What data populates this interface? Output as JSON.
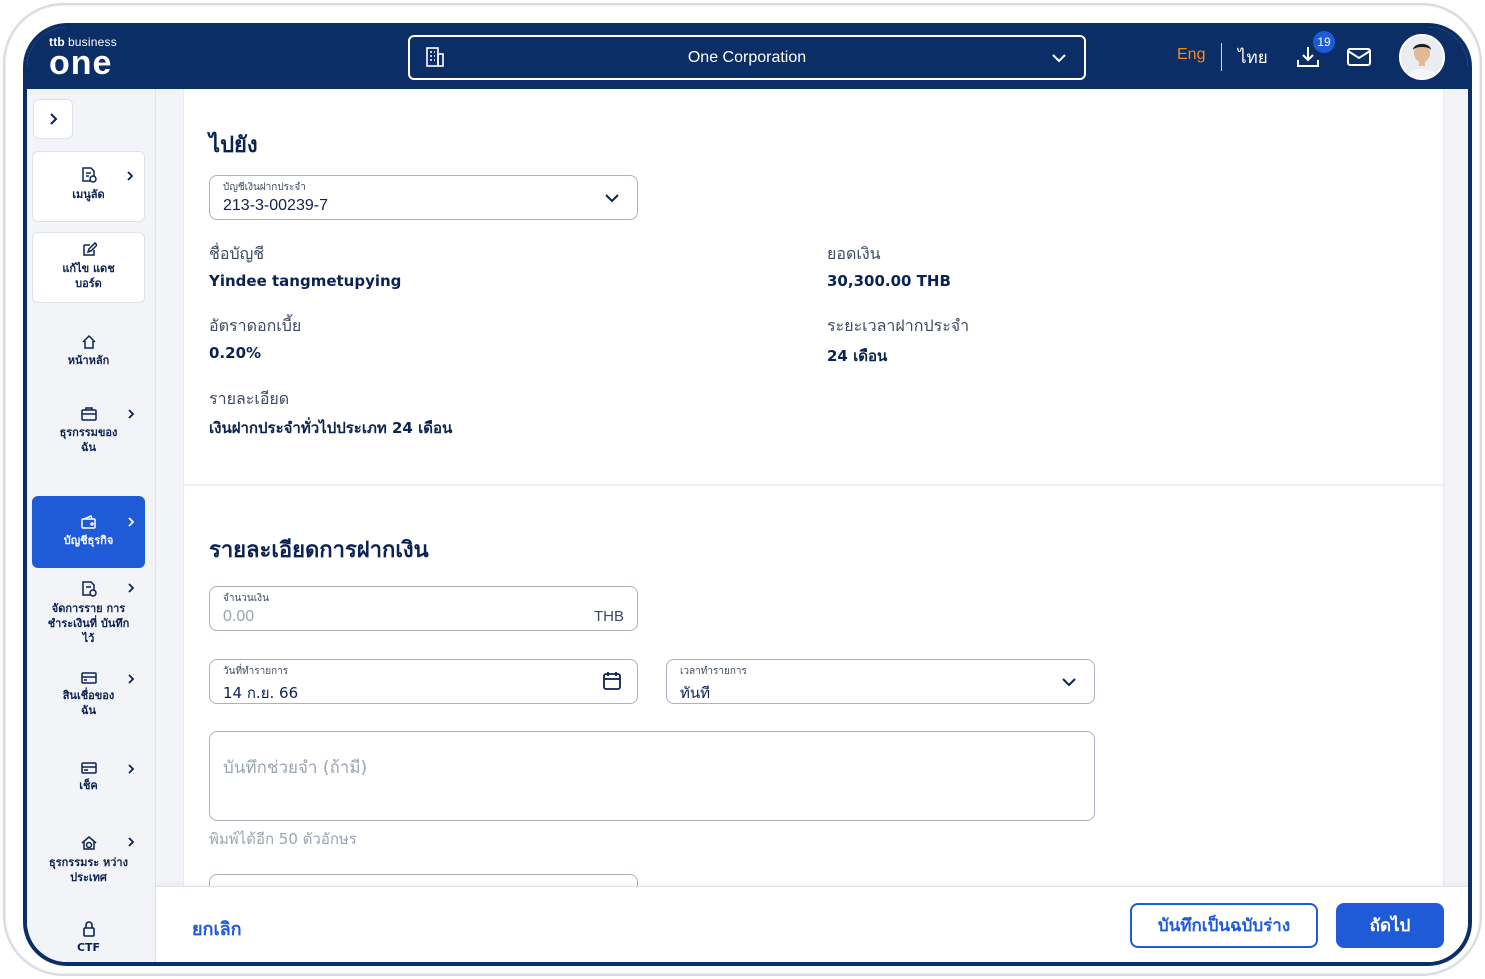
{
  "header": {
    "logo_small_prefix": "ttb",
    "logo_small": "business",
    "logo_big": "one",
    "company": "One Corporation",
    "lang_eng": "Eng",
    "lang_thai": "ไทย",
    "download_badge": "19"
  },
  "sidebar": {
    "items": [
      {
        "label": "เมนูลัด",
        "icon": "document-star-icon"
      },
      {
        "label": "แก้ไข แดชบอร์ด",
        "icon": "edit-icon"
      },
      {
        "label": "หน้าหลัก",
        "icon": "home-icon"
      },
      {
        "label": "ธุรกรรมของ ฉัน",
        "icon": "briefcase-icon"
      },
      {
        "label": "บัญชีธุรกิจ",
        "icon": "wallet-icon"
      },
      {
        "label": "จัดการราย การชำระเงินที่ บันทึกไว้",
        "icon": "document-pay-icon"
      },
      {
        "label": "สินเชื่อของ ฉัน",
        "icon": "card-icon"
      },
      {
        "label": "เช็ค",
        "icon": "cheque-icon"
      },
      {
        "label": "ธุรกรรมระ หว่างประเทศ",
        "icon": "globe-house-icon"
      },
      {
        "label": "CTF",
        "icon": "lock-icon"
      }
    ]
  },
  "destination": {
    "title": "ไปยัง",
    "account_field_label": "บัญชีเงินฝากประจำ",
    "account_number": "213-3-00239-7",
    "account_name_label": "ชื่อบัญชี",
    "account_name": "Yindee tangmetupying",
    "balance_label": "ยอดเงิน",
    "balance": "30,300.00 THB",
    "interest_label": "อัตราดอกเบี้ย",
    "interest": "0.20%",
    "term_label": "ระยะเวลาฝากประจำ",
    "term": "24 เดือน",
    "detail_label": "รายละเอียด",
    "detail": "เงินฝากประจำทั่วไปประเภท 24 เดือน"
  },
  "deposit": {
    "title": "รายละเอียดการฝากเงิน",
    "amount_label": "จำนวนเงิน",
    "amount_placeholder": "0.00",
    "currency": "THB",
    "date_label": "วันที่ทำรายการ",
    "date_value": "14 ก.ย. 66",
    "time_label": "เวลาทำรายการ",
    "time_value": "ทันที",
    "memo_placeholder": "บันทึกช่วยจำ (ถ้ามี)",
    "memo_hint": "พิมพ์ได้อีก 50 ตัวอักษร"
  },
  "footer": {
    "cancel": "ยกเลิก",
    "save_draft": "บันทึกเป็นฉบับร่าง",
    "next": "ถัดไป"
  },
  "colors": {
    "navy": "#0c2e66",
    "primary": "#1f5bd6",
    "accent_orange": "#f08a24"
  }
}
